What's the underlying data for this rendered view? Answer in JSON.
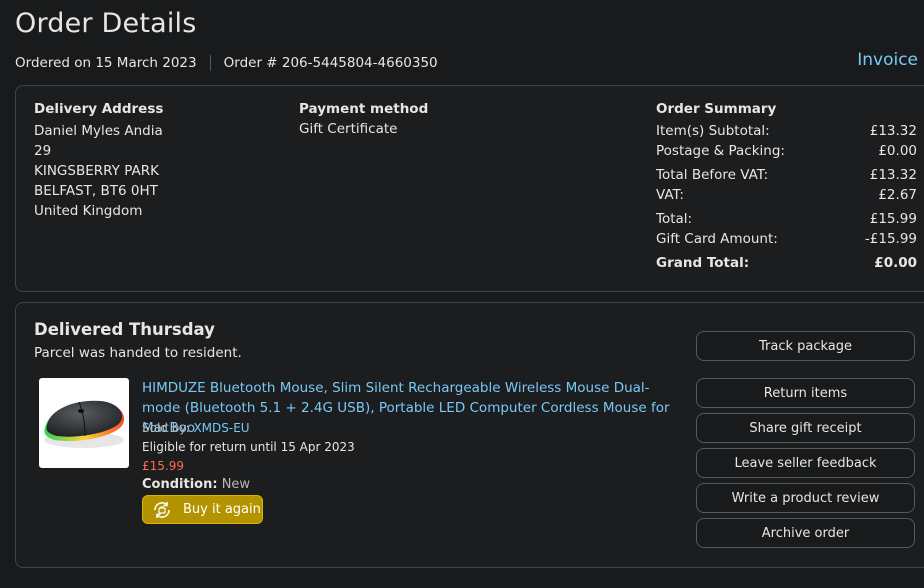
{
  "page": {
    "title": "Order Details"
  },
  "order": {
    "ordered_on": "Ordered on 15 March 2023",
    "order_number": "Order # 206-5445804-4660350",
    "invoice_label": "Invoice"
  },
  "delivery": {
    "heading": "Delivery Address",
    "lines": [
      "Daniel Myles Andia",
      "29",
      "KINGSBERRY PARK",
      "BELFAST, BT6 0HT",
      "United Kingdom"
    ]
  },
  "payment": {
    "heading": "Payment method",
    "method": "Gift Certificate"
  },
  "summary": {
    "heading": "Order Summary",
    "rows": [
      {
        "label": "Item(s) Subtotal:",
        "value": "£13.32"
      },
      {
        "label": "Postage & Packing:",
        "value": "£0.00"
      },
      {
        "label": "Total Before VAT:",
        "value": "£13.32"
      },
      {
        "label": "VAT:",
        "value": "£2.67"
      },
      {
        "label": "Total:",
        "value": "£15.99"
      },
      {
        "label": "Gift Card Amount:",
        "value": "-£15.99"
      },
      {
        "label": "Grand Total:",
        "value": "£0.00"
      }
    ]
  },
  "shipment": {
    "status": "Delivered Thursday",
    "detail": "Parcel was handed to resident."
  },
  "product": {
    "image_icon": "wireless-mouse-image",
    "title": "HIMDUZE Bluetooth Mouse, Slim Silent Rechargeable Wireless Mouse Dual-mode (Bluetooth 5.1 + 2.4G USB), Portable LED Computer Cordless Mouse for MacBoo",
    "sold_by_label": "Sold by:",
    "seller": "XMDS-EU",
    "return_eligibility": "Eligible for return until 15 Apr 2023",
    "price": "£15.99",
    "condition_label": "Condition:",
    "condition_value": "New",
    "buy_again_label": "Buy it again",
    "buy_again_icon": "buy-again-cycle-icon"
  },
  "actions": {
    "track": "Track package",
    "return": "Return items",
    "gift_receipt": "Share gift receipt",
    "seller_feedback": "Leave seller feedback",
    "review": "Write a product review",
    "archive": "Archive order"
  },
  "colors": {
    "background": "#181a1b",
    "link": "#79c9f6",
    "price": "#ff6b4a",
    "buy_again": "#b39400"
  }
}
